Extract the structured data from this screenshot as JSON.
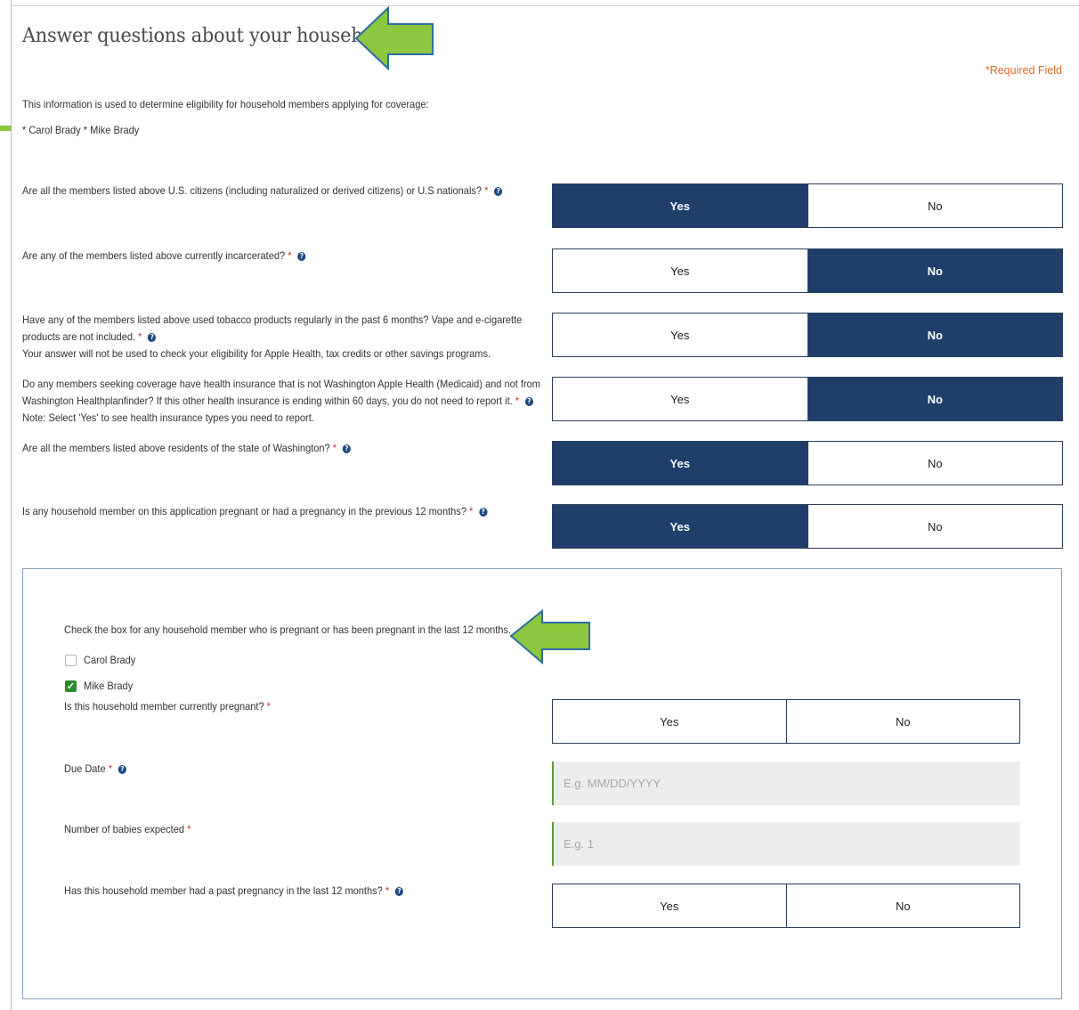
{
  "page": {
    "title": "Answer questions about your household",
    "required_note": "*Required Field",
    "intro": "This information is used to determine eligibility for household members applying for coverage:",
    "members_line": "* Carol Brady * Mike Brady"
  },
  "questions": [
    {
      "text": "Are all the members listed above U.S. citizens (including naturalized or derived citizens) or U.S nationals?",
      "selected": "Yes"
    },
    {
      "text": "Are any of the members listed above currently incarcerated?",
      "selected": "No"
    },
    {
      "text_line1": "Have any of the members listed above used tobacco products regularly in the past 6 months? Vape and e-cigarette",
      "text_line2": "products are not included.",
      "text_line3": "Your answer will not be used to check your eligibility for Apple Health, tax credits or other savings programs.",
      "selected": "No"
    },
    {
      "text_line1": "Do any members seeking coverage have health insurance that is not Washington Apple Health (Medicaid) and not from",
      "text_line2": "Washington Healthplanfinder? If this other health insurance is ending within 60 days, you do not need to report it.",
      "text_line3": "Note: Select 'Yes' to see health insurance types you need to report.",
      "selected": "No"
    },
    {
      "text": "Are all the members listed above residents of the state of Washington?",
      "selected": "Yes"
    },
    {
      "text": "Is any household member on this application pregnant or had a pregnancy in the previous 12 months?",
      "selected": "Yes"
    }
  ],
  "options": {
    "yes": "Yes",
    "no": "No"
  },
  "pregnancy_panel": {
    "instruction": "Check the box for any household member who is pregnant or has been pregnant in the last 12 months.",
    "members": [
      {
        "name": "Carol Brady",
        "checked": false
      },
      {
        "name": "Mike Brady",
        "checked": true
      }
    ],
    "currently_pregnant_label": "Is this household member currently pregnant?",
    "due_date_label": "Due Date",
    "due_date_placeholder": "E.g. MM/DD/YYYY",
    "babies_label": "Number of babies expected",
    "babies_placeholder": "E.g. 1",
    "past_pregnancy_label": "Has this household member had a past pregnancy in the last 12 months?"
  },
  "icons": {
    "help": "question-circle-icon",
    "pointer": "green-arrow-icon",
    "check": "checkmark-icon"
  },
  "colors": {
    "selected": "#1f3f6a",
    "arrow": "#8dc63f",
    "required": "#e06d27",
    "accent_border": "#5aa02c"
  }
}
